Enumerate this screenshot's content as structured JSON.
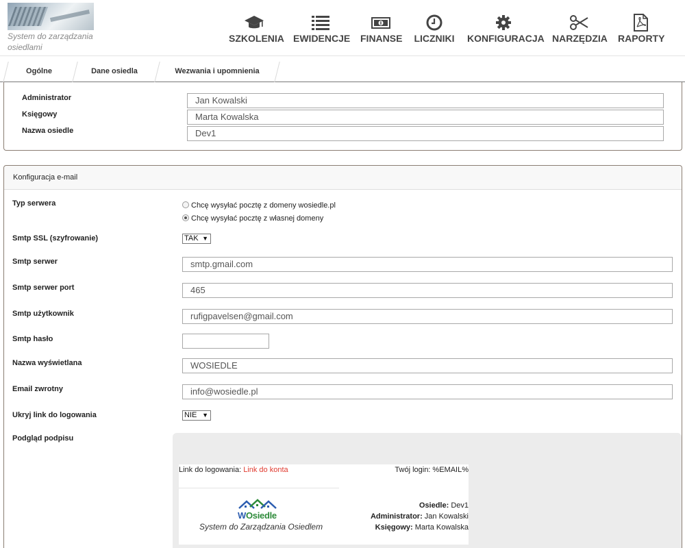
{
  "header": {
    "logo_caption": "System do zarządzania osiedlami",
    "nav": [
      {
        "label": "SZKOLENIA",
        "icon": "graduation-cap-icon"
      },
      {
        "label": "EWIDENCJE",
        "icon": "list-icon"
      },
      {
        "label": "FINANSE",
        "icon": "money-icon"
      },
      {
        "label": "LICZNIKI",
        "icon": "clock-icon"
      },
      {
        "label": "KONFIGURACJA",
        "icon": "gear-icon"
      },
      {
        "label": "NARZĘDZIA",
        "icon": "scissors-icon"
      },
      {
        "label": "RAPORTY",
        "icon": "pdf-icon"
      }
    ]
  },
  "tabs": [
    "Ogólne",
    "Dane osiedla",
    "Wezwania i upomnienia"
  ],
  "general": {
    "administrator_label": "Administrator",
    "administrator_value": "Jan Kowalski",
    "accountant_label": "Księgowy",
    "accountant_value": "Marta Kowalska",
    "estate_name_label": "Nazwa osiedle",
    "estate_name_value": "Dev1"
  },
  "email": {
    "title": "Konfiguracja e-mail",
    "server_type_label": "Typ serwera",
    "server_type_options": [
      "Chcę wysyłać pocztę z domeny wosiedle.pl",
      "Chcę wysyłać pocztę z własnej domeny"
    ],
    "server_type_selected": 1,
    "ssl_label": "Smtp SSL (szyfrowanie)",
    "ssl_value": "TAK",
    "server_label": "Smtp serwer",
    "server_value": "smtp.gmail.com",
    "port_label": "Smtp serwer port",
    "port_value": "465",
    "user_label": "Smtp użytkownik",
    "user_value": "rufigpavelsen@gmail.com",
    "password_label": "Smtp hasło",
    "password_value": "",
    "display_name_label": "Nazwa wyświetlana",
    "display_name_value": "WOSIEDLE",
    "reply_label": "Email zwrotny",
    "reply_value": "info@wosiedle.pl",
    "hide_link_label": "Ukryj link do logowania",
    "hide_link_value": "NIE",
    "preview_label": "Podgląd podpisu"
  },
  "signature": {
    "link_label": "Link do logowania:",
    "link_value": "Link do konta",
    "login_text": "Twój login: %EMAIL%",
    "brand_w": "W",
    "brand_rest": "Osiedle",
    "slogan": "System do Zarządzania Osiedlem",
    "estate_label": "Osiedle:",
    "estate_value": "Dev1",
    "admin_label": "Administrator:",
    "admin_value": "Jan Kowalski",
    "accountant_label": "Księgowy:",
    "accountant_value": "Marta Kowalska"
  },
  "colors": {
    "link": "#e03a2f",
    "panel_border": "#8a7d72",
    "nav_text": "#444444",
    "brand_green": "#2e8b3a",
    "brand_blue": "#2c5db0"
  }
}
